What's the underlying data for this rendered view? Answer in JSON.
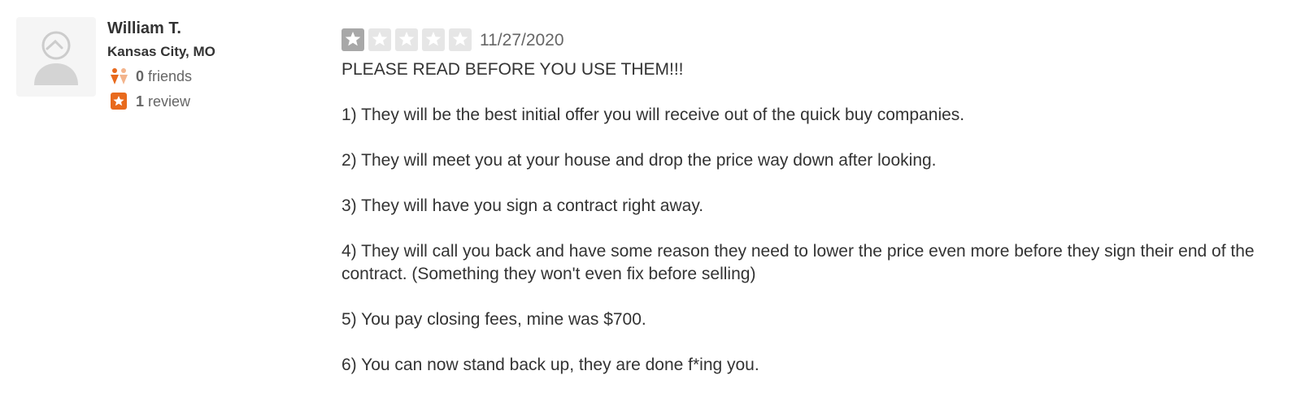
{
  "user": {
    "name": "William T.",
    "location": "Kansas City, MO",
    "friends_count": "0",
    "friends_label": "friends",
    "review_count": "1",
    "review_label": "review",
    "avatar_icon": "default-user-avatar-icon",
    "friends_icon": "friends-icon",
    "reviews_icon": "review-star-icon"
  },
  "review": {
    "rating": 1,
    "rating_max": 5,
    "date": "11/27/2020",
    "paragraphs": [
      "PLEASE READ BEFORE YOU USE THEM!!!",
      "1) They will be the best initial offer you will receive out of the quick buy companies.",
      "2) They will meet you at your house and drop the price way down after looking.",
      "3) They will have you sign a contract right away.",
      "4) They will call you back and have some reason they need to lower the price even more before they sign their end of the contract. (Something they won't even fix before selling)",
      "5) You pay closing fees, mine was $700.",
      "6) You can now stand back up, they are done f*ing you."
    ]
  },
  "colors": {
    "filled_star_bg": "#a8a8a8",
    "empty_star_bg": "#e6e6e6",
    "accent_orange": "#e86a1d",
    "text_primary": "#333333",
    "text_secondary": "#666666"
  }
}
